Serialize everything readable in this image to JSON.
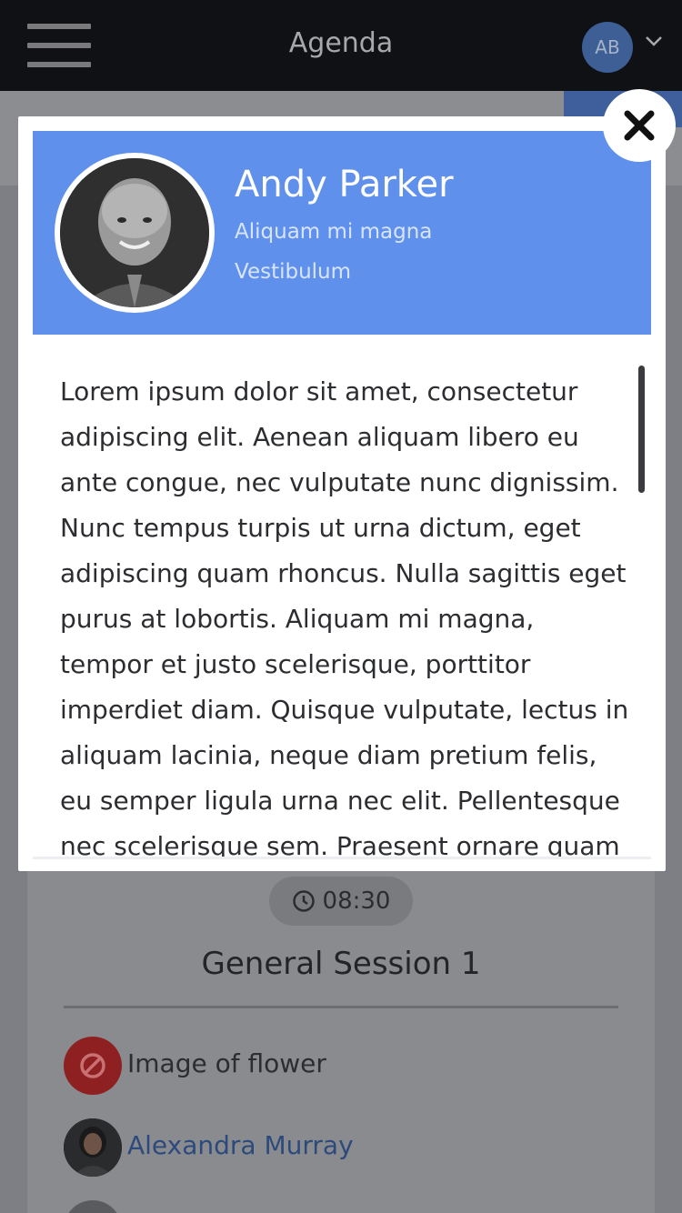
{
  "header": {
    "title": "Agenda",
    "user_initials": "AB"
  },
  "modal": {
    "speaker_name": "Andy Parker",
    "subtitle_1": "Aliquam mi magna",
    "subtitle_2": "Vestibulum",
    "bio": "Lorem ipsum dolor sit amet, consectetur adipiscing elit. Aenean aliquam libero eu ante congue, nec vulputate nunc dignissim. Nunc tempus turpis ut urna dictum, eget adipiscing quam rhoncus. Nulla sagittis eget purus at lobortis. Aliquam mi magna, tempor et justo scelerisque, porttitor imperdiet diam. Quisque vulputate, lectus in aliquam lacinia, neque diam pretium felis, eu semper ligula urna nec elit. Pellentesque nec scelerisque sem. Praesent ornare quam felis, sit amet"
  },
  "session": {
    "time": "08:30",
    "title": "General Session 1",
    "items": [
      {
        "label": "Image of flower"
      },
      {
        "label": "Alexandra Murray"
      }
    ]
  },
  "colors": {
    "topbar": "#101115",
    "accent_blue": "#5f91ec",
    "blocked_red": "#8e2022",
    "link_blue": "#2d4a7c"
  },
  "icons": {
    "menu": "hamburger-icon",
    "dropdown": "chevron-down-icon",
    "close": "close-icon",
    "clock": "clock-icon",
    "blocked": "blocked-icon"
  }
}
